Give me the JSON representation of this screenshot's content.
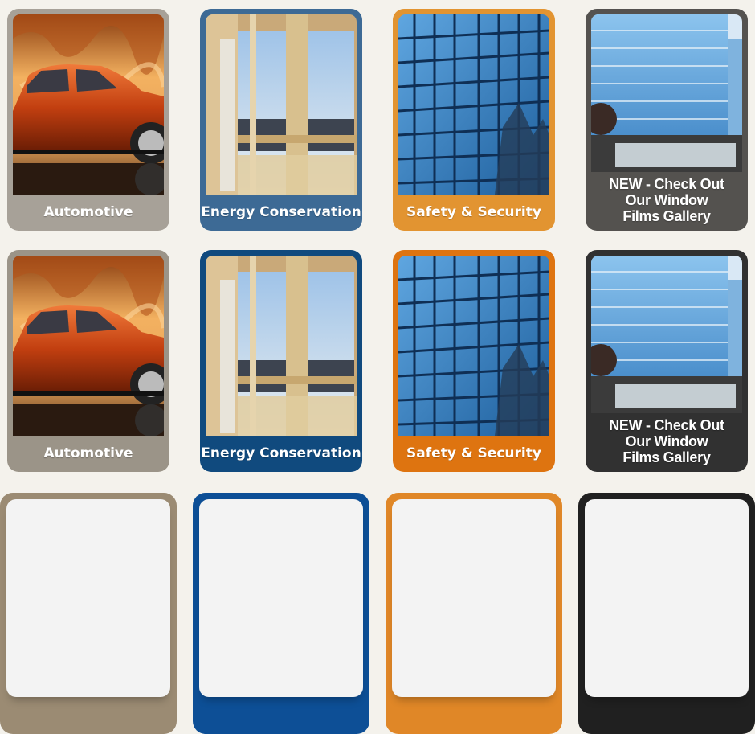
{
  "colors": {
    "row1": [
      "#a7a198",
      "#3d6a95",
      "#e29431",
      "#54524f"
    ],
    "row2": [
      "#9b9488",
      "#104a7e",
      "#de7410",
      "#313131"
    ],
    "row3": [
      "#9b8b73",
      "#0d4f96",
      "#e08727",
      "#202020"
    ]
  },
  "tiles": {
    "row1": [
      {
        "label": "Automotive",
        "icon": "car-photo"
      },
      {
        "label": "Energy Conservation",
        "icon": "window-photo"
      },
      {
        "label": "Safety & Security",
        "icon": "glass-building-photo"
      },
      {
        "label": "NEW - Check Out\nOur Window\nFilms Gallery",
        "icon": "glass-tower-photo"
      }
    ],
    "row2": [
      {
        "label": "Automotive",
        "icon": "car-photo"
      },
      {
        "label": "Energy Conservation",
        "icon": "window-photo"
      },
      {
        "label": "Safety & Security",
        "icon": "glass-building-photo"
      },
      {
        "label": "NEW - Check Out\nOur Window\nFilms Gallery",
        "icon": "glass-tower-photo"
      }
    ]
  }
}
